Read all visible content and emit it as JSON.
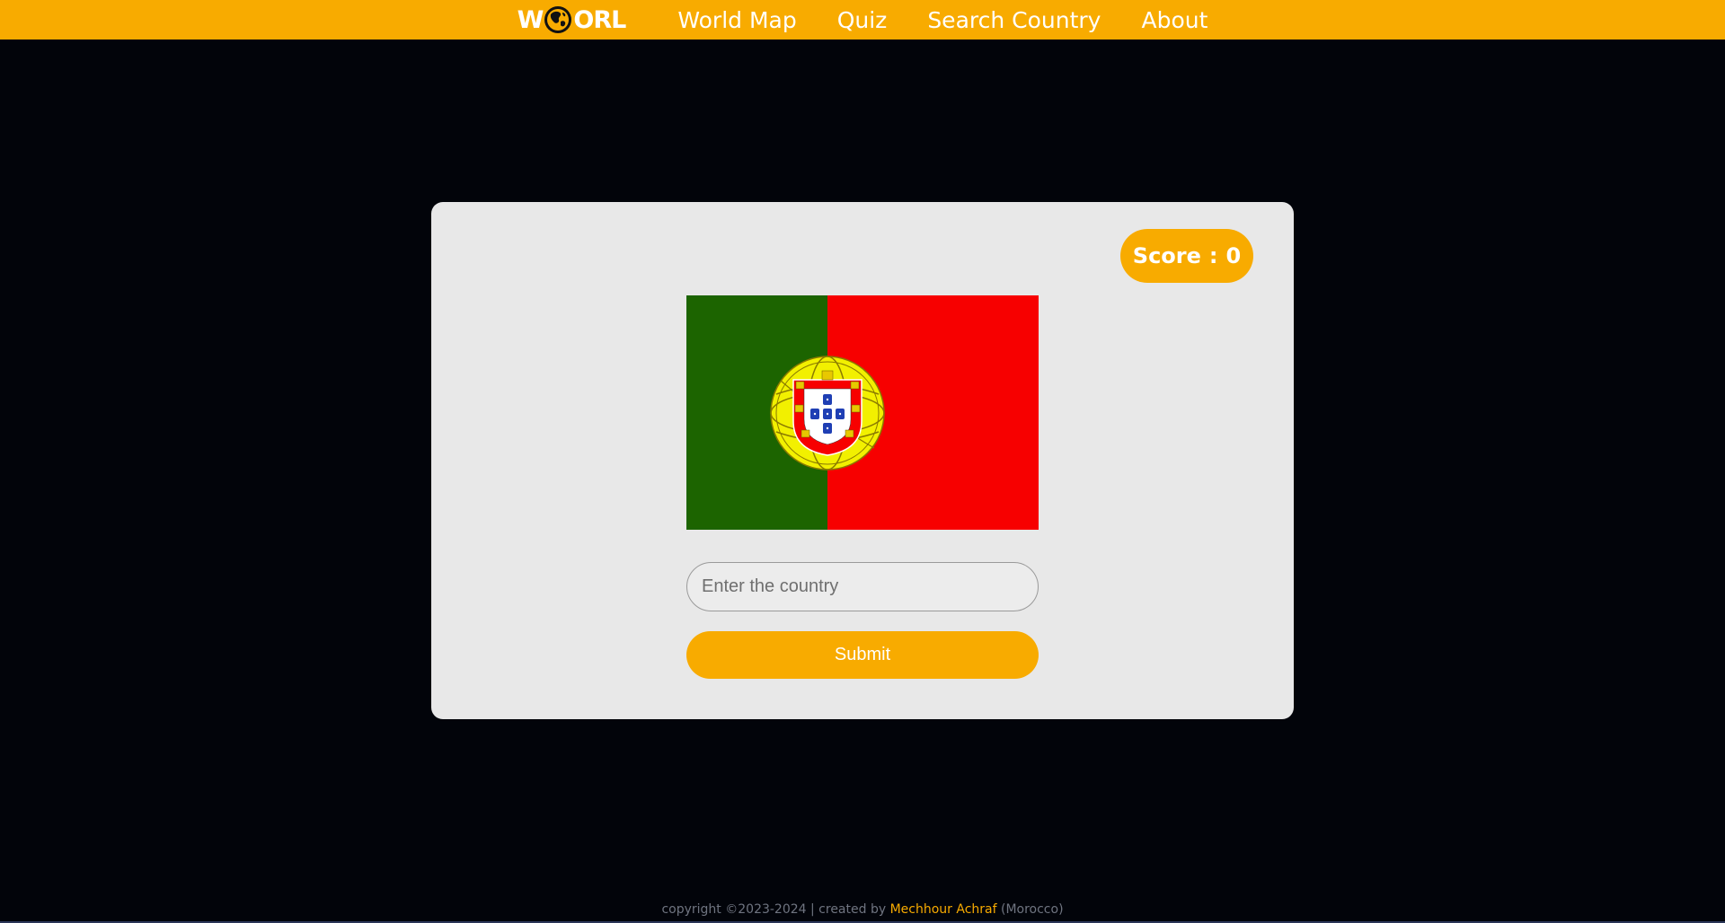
{
  "navbar": {
    "logo": {
      "prefix": "W",
      "suffix": "ORL",
      "icon": "globe-icon"
    },
    "links": [
      {
        "label": "World Map"
      },
      {
        "label": "Quiz"
      },
      {
        "label": "Search Country"
      },
      {
        "label": "About"
      }
    ]
  },
  "quiz": {
    "score_label": "Score",
    "score_separator": ":",
    "score_value": "0",
    "flag_icon": "portugal-flag",
    "input_placeholder": "Enter the country",
    "input_value": "",
    "submit_label": "Submit"
  },
  "footer": {
    "copyright": "copyright ©2023-2024 | created by",
    "author": "Mechhour Achraf",
    "country": "(Morocco)"
  },
  "colors": {
    "accent": "#f8ab00",
    "background": "#02040a",
    "card": "#e8e8e8",
    "flag_green": "#1c6400",
    "flag_red": "#f70000"
  }
}
